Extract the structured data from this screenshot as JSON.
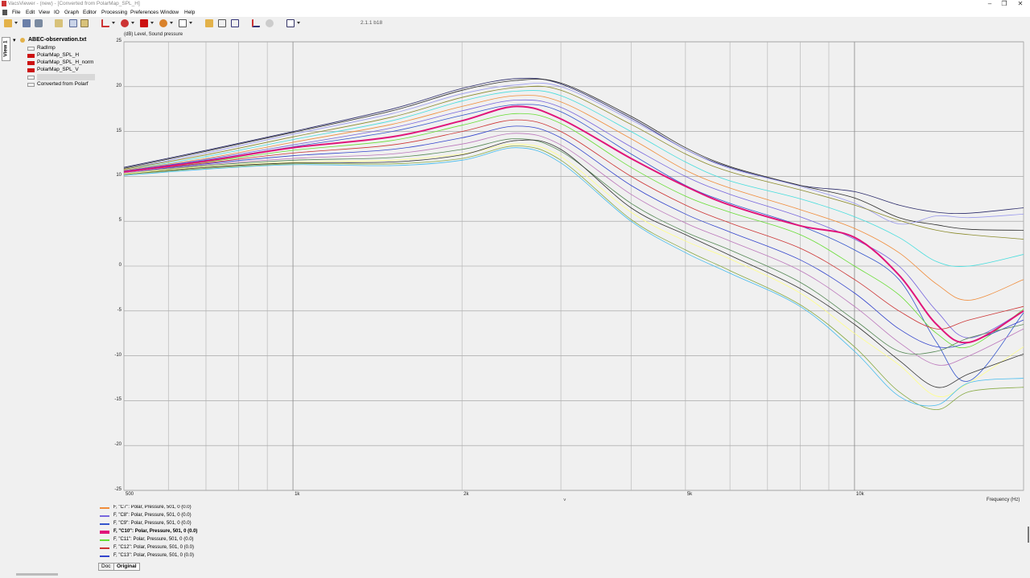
{
  "window": {
    "title": "VacsViewer - (new) - [Converted from PolarMap_SPL_H]",
    "controls": [
      "–",
      "❐",
      "✕"
    ]
  },
  "menu": [
    "File",
    "Edit",
    "View",
    "IO",
    "Graph",
    "Editor",
    "Processing",
    "Preferences",
    "Window",
    "Help"
  ],
  "version": "2.1.1 b18",
  "side_tab": "View 1",
  "tree": {
    "root": "ABEC-observation.txt",
    "items": [
      {
        "label": "RadImp",
        "icon": "curve-icon",
        "selected": false
      },
      {
        "label": "PolarMap_SPL_H",
        "icon": "map-icon",
        "selected": false
      },
      {
        "label": "PolarMap_SPL_H_norm",
        "icon": "map-icon",
        "selected": false
      },
      {
        "label": "PolarMap_SPL_V",
        "icon": "map-icon",
        "selected": false
      },
      {
        "label": "",
        "icon": "curve-icon",
        "selected": true
      },
      {
        "label": "Converted from Polarf",
        "icon": "curve-icon",
        "selected": false
      }
    ]
  },
  "graph": {
    "ylabel": "(dB)  Level, Sound pressure",
    "xlabel": "Frequency  (Hz)",
    "yticks": [
      "25",
      "20",
      "15",
      "10",
      "5",
      "0",
      "-5",
      "-10",
      "-15",
      "-20",
      "-25"
    ],
    "xticks": [
      {
        "label": "500",
        "f": 500
      },
      {
        "label": "1k",
        "f": 1000
      },
      {
        "label": "2k",
        "f": 2000
      },
      {
        "label": "5k",
        "f": 5000
      },
      {
        "label": "10k",
        "f": 10000
      }
    ]
  },
  "chart_data": {
    "type": "line",
    "xscale": "log",
    "xlim": [
      500,
      20000
    ],
    "ylim": [
      -25,
      25
    ],
    "grid": true,
    "x": [
      500,
      700,
      1000,
      1500,
      2000,
      2500,
      3000,
      4000,
      5000,
      6000,
      8000,
      10000,
      12000,
      14000,
      16000,
      20000
    ],
    "series": [
      {
        "color": "#2a2a6a",
        "values": [
          11.0,
          12.9,
          15.0,
          17.5,
          19.8,
          20.9,
          20.3,
          16.5,
          13.0,
          11.0,
          9.0,
          8.3,
          6.8,
          6.0,
          5.9,
          6.5
        ],
        "width": 0.8
      },
      {
        "color": "#2a2a2a",
        "values": [
          10.9,
          12.8,
          14.9,
          17.3,
          19.6,
          20.7,
          20.4,
          16.7,
          13.2,
          11.1,
          9.0,
          7.6,
          5.4,
          4.6,
          4.1,
          4.0
        ],
        "width": 0.8
      },
      {
        "color": "#9a9aee",
        "values": [
          10.8,
          12.6,
          14.7,
          17.0,
          19.2,
          20.2,
          20.0,
          16.3,
          13.0,
          10.9,
          8.9,
          7.0,
          4.7,
          5.6,
          5.4,
          5.8
        ],
        "width": 0.8
      },
      {
        "color": "#8a8a2a",
        "values": [
          10.8,
          12.4,
          14.4,
          16.6,
          18.8,
          19.9,
          19.6,
          15.8,
          12.5,
          10.5,
          8.5,
          6.8,
          5.1,
          4.0,
          3.5,
          3.0
        ],
        "width": 0.8
      },
      {
        "color": "#44dddd",
        "values": [
          10.7,
          12.2,
          14.1,
          16.2,
          18.4,
          19.5,
          19.0,
          15.0,
          11.6,
          9.5,
          7.5,
          5.5,
          3.2,
          0.5,
          0.0,
          1.3
        ],
        "width": 0.8
      },
      {
        "color": "#f08c3a",
        "values": [
          10.7,
          12.0,
          13.8,
          15.8,
          17.8,
          19.0,
          18.3,
          14.2,
          10.7,
          8.7,
          6.3,
          4.2,
          1.5,
          -2.0,
          -3.8,
          -1.5
        ],
        "width": 0.8
      },
      {
        "color": "#7766dd",
        "values": [
          10.6,
          11.9,
          13.5,
          15.4,
          17.3,
          18.5,
          17.7,
          13.3,
          10.0,
          8.0,
          5.5,
          3.0,
          0.0,
          -5.0,
          -8.0,
          -5.0
        ],
        "width": 0.8
      },
      {
        "color": "#3355cc",
        "values": [
          10.6,
          11.8,
          13.3,
          15.0,
          16.8,
          18.0,
          17.2,
          12.5,
          9.0,
          7.0,
          4.5,
          1.8,
          -1.5,
          -8.5,
          -12.8,
          -5.2
        ],
        "width": 0.8
      },
      {
        "color": "#e0157a",
        "values": [
          10.5,
          11.7,
          13.2,
          14.4,
          16.2,
          17.8,
          16.4,
          12.0,
          8.9,
          6.8,
          4.5,
          3.2,
          -1.0,
          -6.5,
          -8.5,
          -5.0
        ],
        "width": 2.0
      },
      {
        "color": "#66dd33",
        "values": [
          10.5,
          11.6,
          12.9,
          14.0,
          15.7,
          17.0,
          15.9,
          11.0,
          7.8,
          6.0,
          3.5,
          0.0,
          -3.2,
          -7.5,
          -9.0,
          -4.8
        ],
        "width": 0.8
      },
      {
        "color": "#cc3333",
        "values": [
          10.5,
          11.5,
          12.6,
          13.5,
          15.0,
          16.3,
          15.0,
          10.0,
          6.8,
          4.8,
          2.0,
          -1.5,
          -5.0,
          -7.0,
          -6.0,
          -4.5
        ],
        "width": 0.8
      },
      {
        "color": "#3344cc",
        "values": [
          10.4,
          11.4,
          12.3,
          13.0,
          14.3,
          15.6,
          14.3,
          9.0,
          5.8,
          3.8,
          0.7,
          -3.0,
          -7.0,
          -9.0,
          -8.5,
          -6.0
        ],
        "width": 0.8
      },
      {
        "color": "#bb77bb",
        "values": [
          10.4,
          11.3,
          12.0,
          12.5,
          13.6,
          14.8,
          13.5,
          8.0,
          4.8,
          2.8,
          -0.5,
          -4.5,
          -8.5,
          -11.0,
          -10.0,
          -7.0
        ],
        "width": 0.8
      },
      {
        "color": "#558855",
        "values": [
          10.3,
          11.2,
          11.8,
          12.1,
          13.0,
          14.2,
          12.8,
          7.0,
          3.8,
          1.8,
          -1.8,
          -6.0,
          -9.5,
          -9.5,
          -8.0,
          -6.5
        ],
        "width": 0.8
      },
      {
        "color": "#ffff88",
        "values": [
          10.3,
          11.1,
          11.6,
          11.8,
          12.5,
          13.6,
          12.2,
          6.0,
          2.8,
          0.8,
          -3.0,
          -7.5,
          -11.0,
          -14.5,
          -13.0,
          -9.0
        ],
        "width": 0.8
      },
      {
        "color": "#333333",
        "values": [
          10.2,
          11.0,
          11.5,
          11.6,
          12.4,
          14.0,
          13.0,
          6.5,
          3.5,
          1.2,
          -2.5,
          -6.5,
          -10.5,
          -13.5,
          -12.0,
          -9.8
        ],
        "width": 0.8
      },
      {
        "color": "#88aa44",
        "values": [
          10.2,
          10.9,
          11.4,
          11.4,
          12.0,
          13.4,
          11.8,
          5.2,
          1.8,
          -0.5,
          -4.3,
          -9.0,
          -14.0,
          -16.0,
          -14.0,
          -13.5
        ],
        "width": 0.8
      },
      {
        "color": "#44bbee",
        "values": [
          10.1,
          10.8,
          11.3,
          11.2,
          11.8,
          13.2,
          11.5,
          5.0,
          1.5,
          -0.8,
          -4.5,
          -9.5,
          -14.5,
          -15.5,
          -13.0,
          -12.5
        ],
        "width": 0.8
      }
    ]
  },
  "legend": [
    {
      "color": "#f08c3a",
      "text": "F, \"C7\": Polar, Pressure, 501, 0 (0.0)",
      "bold": false
    },
    {
      "color": "#7766dd",
      "text": "F, \"C8\": Polar, Pressure, 501, 0 (0.0)",
      "bold": false
    },
    {
      "color": "#3355cc",
      "text": "F, \"C9\": Polar, Pressure, 501, 0 (0.0)",
      "bold": false
    },
    {
      "color": "#e0157a",
      "text": "F, \"C10\": Polar, Pressure, 501, 0 (0.0)",
      "bold": true
    },
    {
      "color": "#66dd33",
      "text": "F, \"C11\": Polar, Pressure, 501, 0 (0.0)",
      "bold": false
    },
    {
      "color": "#cc3333",
      "text": "F, \"C12\": Polar, Pressure, 501, 0 (0.0)",
      "bold": false
    },
    {
      "color": "#3344cc",
      "text": "F, \"C13\": Polar, Pressure, 501, 0 (0.0)",
      "bold": false
    }
  ],
  "doc_tabs": [
    {
      "label": "Doc",
      "active": false
    },
    {
      "label": "Original",
      "active": true
    }
  ]
}
